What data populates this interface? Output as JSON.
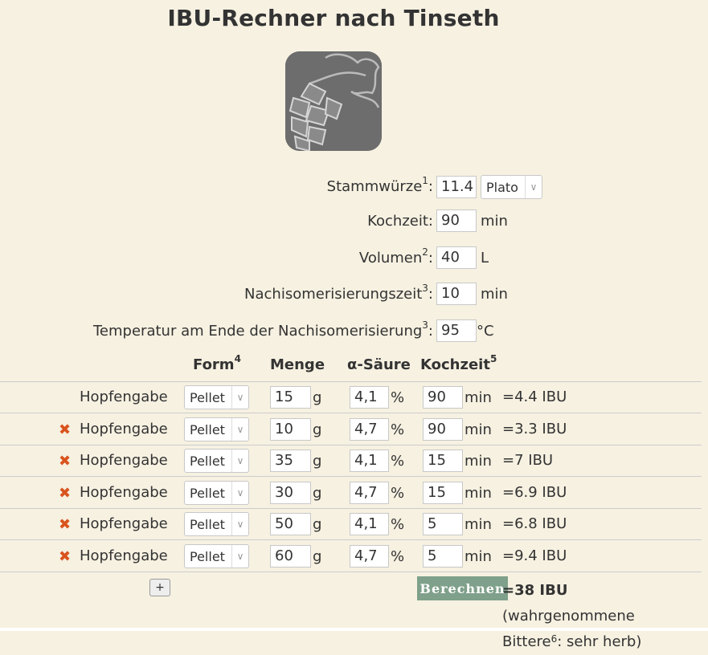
{
  "title": "IBU-Rechner nach Tinseth",
  "params": {
    "stammwuerze": {
      "label": "Stammwürze",
      "sup": "1",
      "value": "11.4",
      "unit_select": "Plato"
    },
    "kochzeit": {
      "label": "Kochzeit",
      "value": "90",
      "unit": "min"
    },
    "volumen": {
      "label": "Volumen",
      "sup": "2",
      "value": "40",
      "unit": "L"
    },
    "nachiso_zeit": {
      "label": "Nachisomerisierungszeit",
      "sup": "3",
      "value": "10",
      "unit": "min"
    },
    "nachiso_temp": {
      "label": "Temperatur am Ende der Nachisomerisierung",
      "sup": "3",
      "value": "95",
      "unit": "°C"
    }
  },
  "headers": {
    "form": "Form",
    "form_sup": "4",
    "menge": "Menge",
    "saeure": "α-Säure",
    "kochzeit": "Kochzeit",
    "kochzeit_sup": "5"
  },
  "units": {
    "menge": "g",
    "saeure": "%",
    "zeit": "min"
  },
  "hop_label": "Hopfengabe",
  "remove_icon": "✖",
  "hops": [
    {
      "form": "Pellet",
      "menge": "15",
      "saeure": "4,1",
      "zeit": "90",
      "ibu": "=4.4 IBU"
    },
    {
      "form": "Pellet",
      "menge": "10",
      "saeure": "4,7",
      "zeit": "90",
      "ibu": "=3.3 IBU"
    },
    {
      "form": "Pellet",
      "menge": "35",
      "saeure": "4,1",
      "zeit": "15",
      "ibu": "=7 IBU"
    },
    {
      "form": "Pellet",
      "menge": "30",
      "saeure": "4,7",
      "zeit": "15",
      "ibu": "=6.9 IBU"
    },
    {
      "form": "Pellet",
      "menge": "50",
      "saeure": "4,1",
      "zeit": "5",
      "ibu": "=6.8 IBU"
    },
    {
      "form": "Pellet",
      "menge": "60",
      "saeure": "4,7",
      "zeit": "5",
      "ibu": "=9.4 IBU"
    }
  ],
  "add_button": "+",
  "calc_button": "Berechnen",
  "result": {
    "total": "=38 IBU",
    "text1": " (wahrgenommene",
    "text2": "Bittere",
    "sup": "6",
    "text3": ": sehr herb)"
  },
  "colors": {
    "background": "#f6f1e1",
    "accent": "#7fa08a",
    "remove": "#d9531e"
  }
}
